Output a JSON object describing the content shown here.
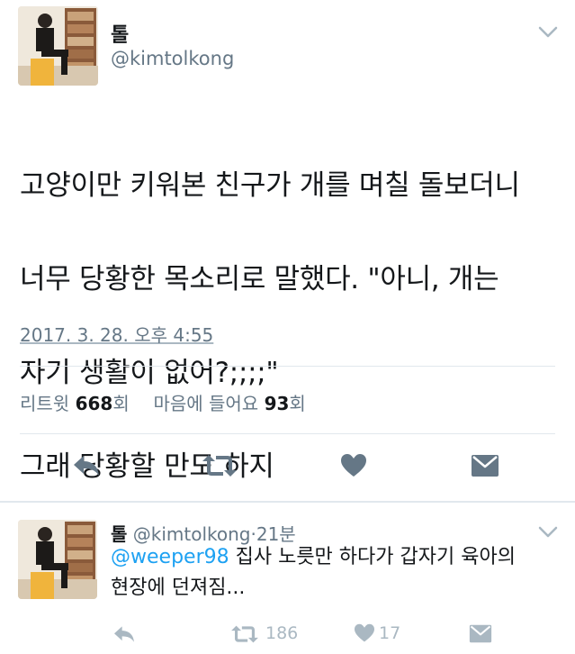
{
  "main_tweet": {
    "display_name": "톨",
    "handle": "@kimtolkong",
    "text_lines": [
      "고양이만 키워본 친구가 개를 며칠 돌보더니",
      "너무 당황한 목소리로 말했다. \"아니, 개는",
      "자기 생활이 없어?;;;;\"",
      "그래 당황할 만도 하지"
    ],
    "timestamp": "2017. 3. 28. 오후 4:55",
    "stats": {
      "retweet_label": "리트윗",
      "retweet_count": "668",
      "retweet_unit": "회",
      "like_label": "마음에 들어요",
      "like_count": "93",
      "like_unit": "회"
    },
    "actions": [
      "reply-icon",
      "retweet-icon",
      "heart-icon",
      "dm-icon"
    ]
  },
  "reply_tweet": {
    "display_name": "톨",
    "handle": "@kimtolkong",
    "separator": "·",
    "time_ago": "21분",
    "mention": "@weeper98",
    "text_rest": " 집사 노릇만 하다가 갑자기 육아의",
    "text_line2": "현장에 던져짐...",
    "retweet_count": "186",
    "like_count": "17"
  },
  "colors": {
    "text": "#14171a",
    "muted": "#657786",
    "icon": "#657786",
    "icon_light": "#aab8c2",
    "link": "#1da1f2",
    "divider": "#e1e8ed"
  }
}
